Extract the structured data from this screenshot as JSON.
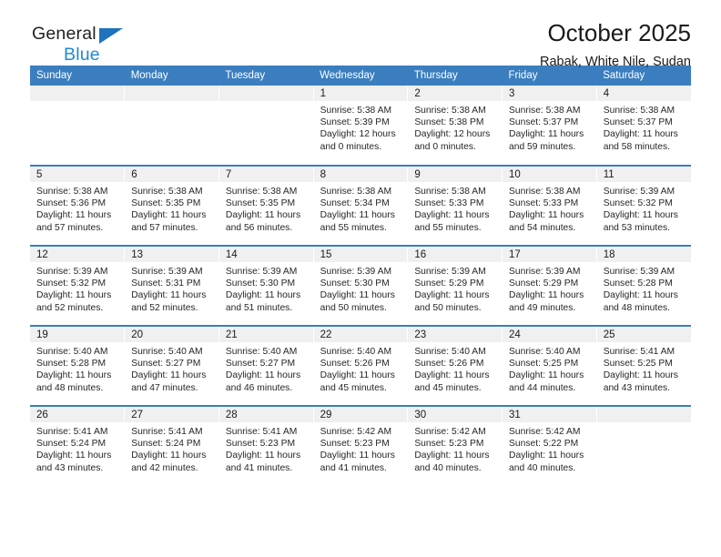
{
  "brand": {
    "name_top": "General",
    "name_bottom": "Blue",
    "accent_color": "#1f72bd",
    "accent_color_light": "#1f88d8"
  },
  "header": {
    "title": "October 2025",
    "subtitle": "Rabak, White Nile, Sudan"
  },
  "theme": {
    "header_bg": "#3b7ebf",
    "daynum_bg": "#f0f0f0",
    "text": "#1a1a1a"
  },
  "weekday_headers": [
    "Sunday",
    "Monday",
    "Tuesday",
    "Wednesday",
    "Thursday",
    "Friday",
    "Saturday"
  ],
  "labels": {
    "sunrise_prefix": "Sunrise:",
    "sunset_prefix": "Sunset:",
    "daylight_prefix": "Daylight:"
  },
  "weeks": [
    [
      {
        "day": "",
        "empty": true
      },
      {
        "day": "",
        "empty": true
      },
      {
        "day": "",
        "empty": true
      },
      {
        "day": "1",
        "sunrise": "Sunrise: 5:38 AM",
        "sunset": "Sunset: 5:39 PM",
        "daylight_line1": "Daylight: 12 hours",
        "daylight_line2": "and 0 minutes."
      },
      {
        "day": "2",
        "sunrise": "Sunrise: 5:38 AM",
        "sunset": "Sunset: 5:38 PM",
        "daylight_line1": "Daylight: 12 hours",
        "daylight_line2": "and 0 minutes."
      },
      {
        "day": "3",
        "sunrise": "Sunrise: 5:38 AM",
        "sunset": "Sunset: 5:37 PM",
        "daylight_line1": "Daylight: 11 hours",
        "daylight_line2": "and 59 minutes."
      },
      {
        "day": "4",
        "sunrise": "Sunrise: 5:38 AM",
        "sunset": "Sunset: 5:37 PM",
        "daylight_line1": "Daylight: 11 hours",
        "daylight_line2": "and 58 minutes."
      }
    ],
    [
      {
        "day": "5",
        "sunrise": "Sunrise: 5:38 AM",
        "sunset": "Sunset: 5:36 PM",
        "daylight_line1": "Daylight: 11 hours",
        "daylight_line2": "and 57 minutes."
      },
      {
        "day": "6",
        "sunrise": "Sunrise: 5:38 AM",
        "sunset": "Sunset: 5:35 PM",
        "daylight_line1": "Daylight: 11 hours",
        "daylight_line2": "and 57 minutes."
      },
      {
        "day": "7",
        "sunrise": "Sunrise: 5:38 AM",
        "sunset": "Sunset: 5:35 PM",
        "daylight_line1": "Daylight: 11 hours",
        "daylight_line2": "and 56 minutes."
      },
      {
        "day": "8",
        "sunrise": "Sunrise: 5:38 AM",
        "sunset": "Sunset: 5:34 PM",
        "daylight_line1": "Daylight: 11 hours",
        "daylight_line2": "and 55 minutes."
      },
      {
        "day": "9",
        "sunrise": "Sunrise: 5:38 AM",
        "sunset": "Sunset: 5:33 PM",
        "daylight_line1": "Daylight: 11 hours",
        "daylight_line2": "and 55 minutes."
      },
      {
        "day": "10",
        "sunrise": "Sunrise: 5:38 AM",
        "sunset": "Sunset: 5:33 PM",
        "daylight_line1": "Daylight: 11 hours",
        "daylight_line2": "and 54 minutes."
      },
      {
        "day": "11",
        "sunrise": "Sunrise: 5:39 AM",
        "sunset": "Sunset: 5:32 PM",
        "daylight_line1": "Daylight: 11 hours",
        "daylight_line2": "and 53 minutes."
      }
    ],
    [
      {
        "day": "12",
        "sunrise": "Sunrise: 5:39 AM",
        "sunset": "Sunset: 5:32 PM",
        "daylight_line1": "Daylight: 11 hours",
        "daylight_line2": "and 52 minutes."
      },
      {
        "day": "13",
        "sunrise": "Sunrise: 5:39 AM",
        "sunset": "Sunset: 5:31 PM",
        "daylight_line1": "Daylight: 11 hours",
        "daylight_line2": "and 52 minutes."
      },
      {
        "day": "14",
        "sunrise": "Sunrise: 5:39 AM",
        "sunset": "Sunset: 5:30 PM",
        "daylight_line1": "Daylight: 11 hours",
        "daylight_line2": "and 51 minutes."
      },
      {
        "day": "15",
        "sunrise": "Sunrise: 5:39 AM",
        "sunset": "Sunset: 5:30 PM",
        "daylight_line1": "Daylight: 11 hours",
        "daylight_line2": "and 50 minutes."
      },
      {
        "day": "16",
        "sunrise": "Sunrise: 5:39 AM",
        "sunset": "Sunset: 5:29 PM",
        "daylight_line1": "Daylight: 11 hours",
        "daylight_line2": "and 50 minutes."
      },
      {
        "day": "17",
        "sunrise": "Sunrise: 5:39 AM",
        "sunset": "Sunset: 5:29 PM",
        "daylight_line1": "Daylight: 11 hours",
        "daylight_line2": "and 49 minutes."
      },
      {
        "day": "18",
        "sunrise": "Sunrise: 5:39 AM",
        "sunset": "Sunset: 5:28 PM",
        "daylight_line1": "Daylight: 11 hours",
        "daylight_line2": "and 48 minutes."
      }
    ],
    [
      {
        "day": "19",
        "sunrise": "Sunrise: 5:40 AM",
        "sunset": "Sunset: 5:28 PM",
        "daylight_line1": "Daylight: 11 hours",
        "daylight_line2": "and 48 minutes."
      },
      {
        "day": "20",
        "sunrise": "Sunrise: 5:40 AM",
        "sunset": "Sunset: 5:27 PM",
        "daylight_line1": "Daylight: 11 hours",
        "daylight_line2": "and 47 minutes."
      },
      {
        "day": "21",
        "sunrise": "Sunrise: 5:40 AM",
        "sunset": "Sunset: 5:27 PM",
        "daylight_line1": "Daylight: 11 hours",
        "daylight_line2": "and 46 minutes."
      },
      {
        "day": "22",
        "sunrise": "Sunrise: 5:40 AM",
        "sunset": "Sunset: 5:26 PM",
        "daylight_line1": "Daylight: 11 hours",
        "daylight_line2": "and 45 minutes."
      },
      {
        "day": "23",
        "sunrise": "Sunrise: 5:40 AM",
        "sunset": "Sunset: 5:26 PM",
        "daylight_line1": "Daylight: 11 hours",
        "daylight_line2": "and 45 minutes."
      },
      {
        "day": "24",
        "sunrise": "Sunrise: 5:40 AM",
        "sunset": "Sunset: 5:25 PM",
        "daylight_line1": "Daylight: 11 hours",
        "daylight_line2": "and 44 minutes."
      },
      {
        "day": "25",
        "sunrise": "Sunrise: 5:41 AM",
        "sunset": "Sunset: 5:25 PM",
        "daylight_line1": "Daylight: 11 hours",
        "daylight_line2": "and 43 minutes."
      }
    ],
    [
      {
        "day": "26",
        "sunrise": "Sunrise: 5:41 AM",
        "sunset": "Sunset: 5:24 PM",
        "daylight_line1": "Daylight: 11 hours",
        "daylight_line2": "and 43 minutes."
      },
      {
        "day": "27",
        "sunrise": "Sunrise: 5:41 AM",
        "sunset": "Sunset: 5:24 PM",
        "daylight_line1": "Daylight: 11 hours",
        "daylight_line2": "and 42 minutes."
      },
      {
        "day": "28",
        "sunrise": "Sunrise: 5:41 AM",
        "sunset": "Sunset: 5:23 PM",
        "daylight_line1": "Daylight: 11 hours",
        "daylight_line2": "and 41 minutes."
      },
      {
        "day": "29",
        "sunrise": "Sunrise: 5:42 AM",
        "sunset": "Sunset: 5:23 PM",
        "daylight_line1": "Daylight: 11 hours",
        "daylight_line2": "and 41 minutes."
      },
      {
        "day": "30",
        "sunrise": "Sunrise: 5:42 AM",
        "sunset": "Sunset: 5:23 PM",
        "daylight_line1": "Daylight: 11 hours",
        "daylight_line2": "and 40 minutes."
      },
      {
        "day": "31",
        "sunrise": "Sunrise: 5:42 AM",
        "sunset": "Sunset: 5:22 PM",
        "daylight_line1": "Daylight: 11 hours",
        "daylight_line2": "and 40 minutes."
      },
      {
        "day": "",
        "empty": true
      }
    ]
  ]
}
